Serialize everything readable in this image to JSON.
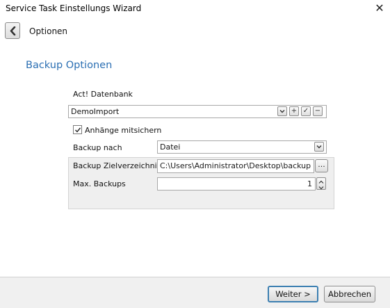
{
  "window": {
    "title": "Service Task Einstellungs Wizard",
    "close": "✕"
  },
  "nav": {
    "back_icon": "chevron-left-icon",
    "title": "Optionen"
  },
  "section": {
    "title": "Backup Optionen"
  },
  "database": {
    "label": "Act! Datenbank",
    "value": "DemoImport",
    "buttons": {
      "dropdown": "chevron-down-icon",
      "add": "+",
      "confirm": "✓",
      "remove": "−"
    }
  },
  "attachments": {
    "label": "Anhänge mitsichern",
    "checked": true
  },
  "backup_to": {
    "label": "Backup nach",
    "value": "Datei"
  },
  "target_dir": {
    "label": "Backup Zielverzeichnis",
    "value": "C:\\Users\\Administrator\\Desktop\\backup service",
    "browse_label": "..."
  },
  "max_backups": {
    "label": "Max. Backups",
    "value": "1"
  },
  "footer": {
    "next_label": "Weiter >",
    "cancel_label": "Abbrechen"
  }
}
